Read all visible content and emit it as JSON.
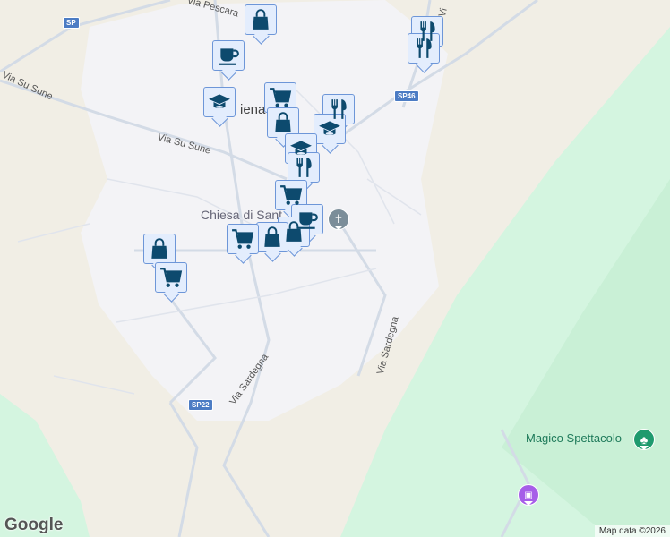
{
  "map": {
    "town_label_partial": "iena",
    "church_label": "Chiesa di Sant",
    "poi_label": "Magico Spettacolo",
    "streets": [
      "Via Pescara",
      "Via Su Sune",
      "Via Su Sune",
      "Via Sardegna",
      "Via Sardegna",
      "Vi"
    ],
    "road_shields": [
      "SP",
      "SP46",
      "SP22"
    ],
    "attribution": "Map data ©2026",
    "logo": "Google",
    "colors": {
      "marker_fill": "#e3edfd",
      "marker_border": "#6d96d8",
      "icon": "#0d4a6e",
      "park": "#d4f5e0",
      "town": "#f3f3f6"
    }
  },
  "markers": [
    {
      "type": "shopping-bag"
    },
    {
      "type": "cafe"
    },
    {
      "type": "school"
    },
    {
      "type": "grocery"
    },
    {
      "type": "restaurant"
    },
    {
      "type": "shopping-bag"
    },
    {
      "type": "school"
    },
    {
      "type": "school"
    },
    {
      "type": "restaurant"
    },
    {
      "type": "grocery"
    },
    {
      "type": "cafe"
    },
    {
      "type": "shopping-bag"
    },
    {
      "type": "shopping-bag"
    },
    {
      "type": "grocery"
    },
    {
      "type": "shopping-bag"
    },
    {
      "type": "grocery"
    },
    {
      "type": "restaurant"
    },
    {
      "type": "restaurant"
    }
  ]
}
